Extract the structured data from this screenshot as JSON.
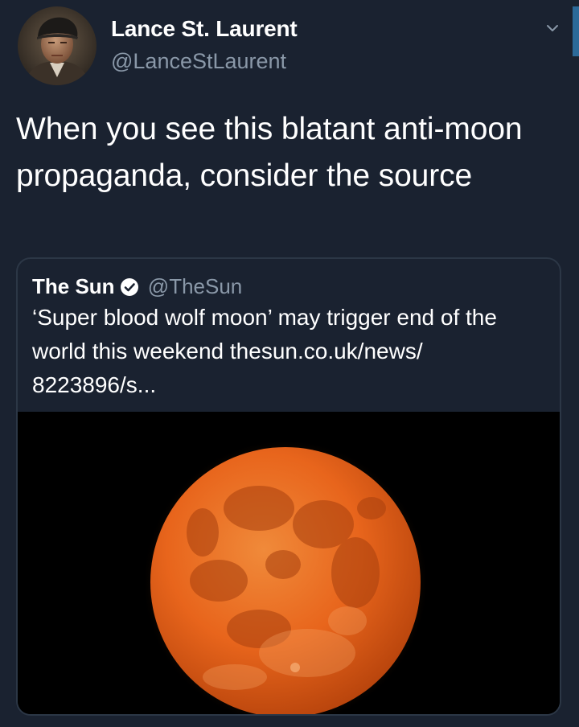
{
  "tweet": {
    "author": {
      "display_name": "Lance St. Laurent",
      "handle": "@LanceStLaurent",
      "avatar_icon": "profile-photo-avatar"
    },
    "menu_icon": "chevron-down-icon",
    "text": "When you see this blatant anti-moon propaganda, consider the source"
  },
  "quoted_tweet": {
    "display_name": "The Sun",
    "verified_icon": "verified-badge-icon",
    "handle": "@TheSun",
    "text": "‘Super blood wolf moon’ may trigger end of the world this weekend thesun.co.uk/news/ 8223896/s...",
    "media": {
      "subject": "orange full moon",
      "moon_color": "#e8651c",
      "background_color": "#000000"
    }
  },
  "theme": {
    "background": "#1a2230",
    "text_primary": "#ffffff",
    "text_secondary": "#8a98a8",
    "border": "#2c3746"
  }
}
